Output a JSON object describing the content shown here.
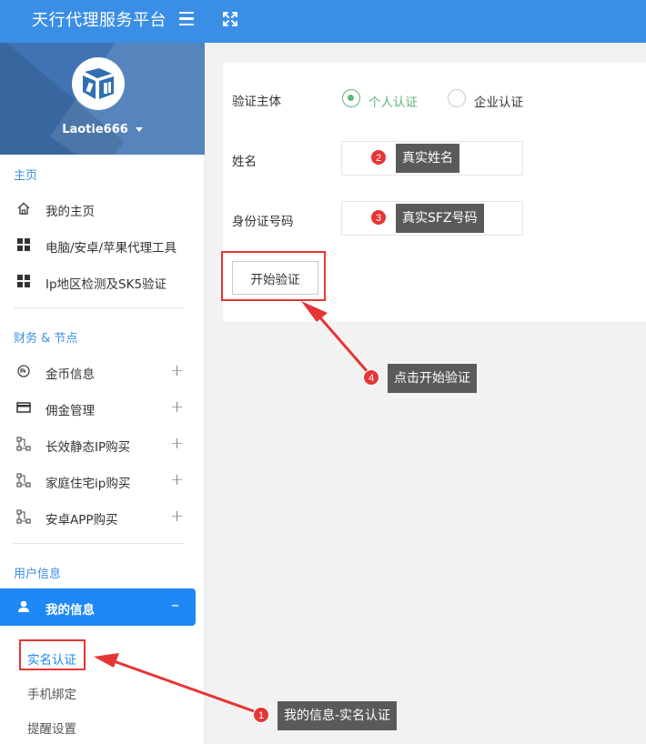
{
  "app": {
    "title": "天行代理服务平台"
  },
  "user": {
    "name": "Laotie666"
  },
  "sidebar": {
    "sections": [
      {
        "title": "主页"
      },
      {
        "title": "财务 & 节点"
      },
      {
        "title": "用户信息"
      }
    ],
    "home_items": [
      {
        "label": "我的主页",
        "icon": "home-icon"
      },
      {
        "label": "电脑/安卓/苹果代理工具",
        "icon": "grid-icon"
      },
      {
        "label": "Ip地区检测及SK5验证",
        "icon": "grid-icon"
      }
    ],
    "finance_items": [
      {
        "label": "金币信息",
        "icon": "coin-icon",
        "expand": "+"
      },
      {
        "label": "佣金管理",
        "icon": "card-icon",
        "expand": "+"
      },
      {
        "label": "长效静态IP购买",
        "icon": "nodes-icon",
        "expand": "+"
      },
      {
        "label": "家庭住宅ip购买",
        "icon": "nodes-icon",
        "expand": "+"
      },
      {
        "label": "安卓APP购买",
        "icon": "nodes-icon",
        "expand": "+"
      }
    ],
    "active_item": {
      "label": "我的信息",
      "icon": "user-icon",
      "collapse": "–"
    },
    "sub_items": [
      {
        "label": "实名认证",
        "current": true
      },
      {
        "label": "手机绑定"
      },
      {
        "label": "提醒设置"
      }
    ]
  },
  "form": {
    "subject_label": "验证主体",
    "options": [
      {
        "label": "个人认证",
        "selected": true
      },
      {
        "label": "企业认证",
        "selected": false
      }
    ],
    "name_label": "姓名",
    "id_label": "身份证号码",
    "start_button": "开始验证"
  },
  "annotations": [
    {
      "num": "1",
      "text": "我的信息-实名认证"
    },
    {
      "num": "2",
      "text": "真实姓名"
    },
    {
      "num": "3",
      "text": "真实SFZ号码"
    },
    {
      "num": "4",
      "text": "点击开始验证"
    }
  ],
  "colors": {
    "topbar": "#3a8ee6",
    "active": "#1e88f5",
    "accent_green": "#5fb878",
    "annotation_red": "#e53535"
  }
}
